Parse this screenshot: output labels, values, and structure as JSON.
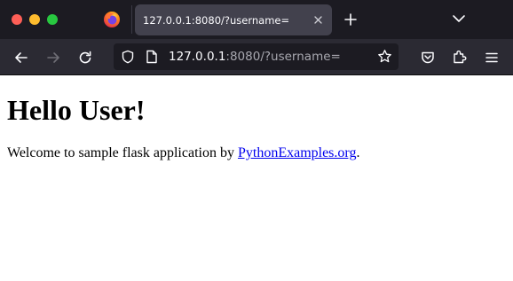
{
  "browser": {
    "tab": {
      "title": "127.0.0.1:8080/?username=",
      "close_icon": "close-icon"
    },
    "url": {
      "host": "127.0.0.1",
      "rest": ":8080/?username="
    },
    "icons": {
      "firefox": "firefox-logo-icon",
      "new_tab": "plus-icon",
      "list_tabs": "chevron-down-icon",
      "back": "arrow-left-icon",
      "forward": "arrow-right-icon",
      "reload": "reload-icon",
      "shield": "shield-icon",
      "page": "page-icon",
      "star": "star-icon",
      "pocket": "pocket-icon",
      "extensions": "puzzle-icon",
      "menu": "hamburger-menu-icon"
    },
    "colors": {
      "tabstrip_bg": "#1c1b22",
      "toolbar_bg": "#2b2a33",
      "active_tab_bg": "#42414d",
      "traffic_close": "#fe5f57",
      "traffic_min": "#febc2e",
      "traffic_max": "#28c840",
      "link": "#0000ee"
    }
  },
  "page": {
    "heading": "Hello User!",
    "welcome_prefix": "Welcome to sample flask application by ",
    "link_text": "PythonExamples.org",
    "welcome_suffix": "."
  }
}
